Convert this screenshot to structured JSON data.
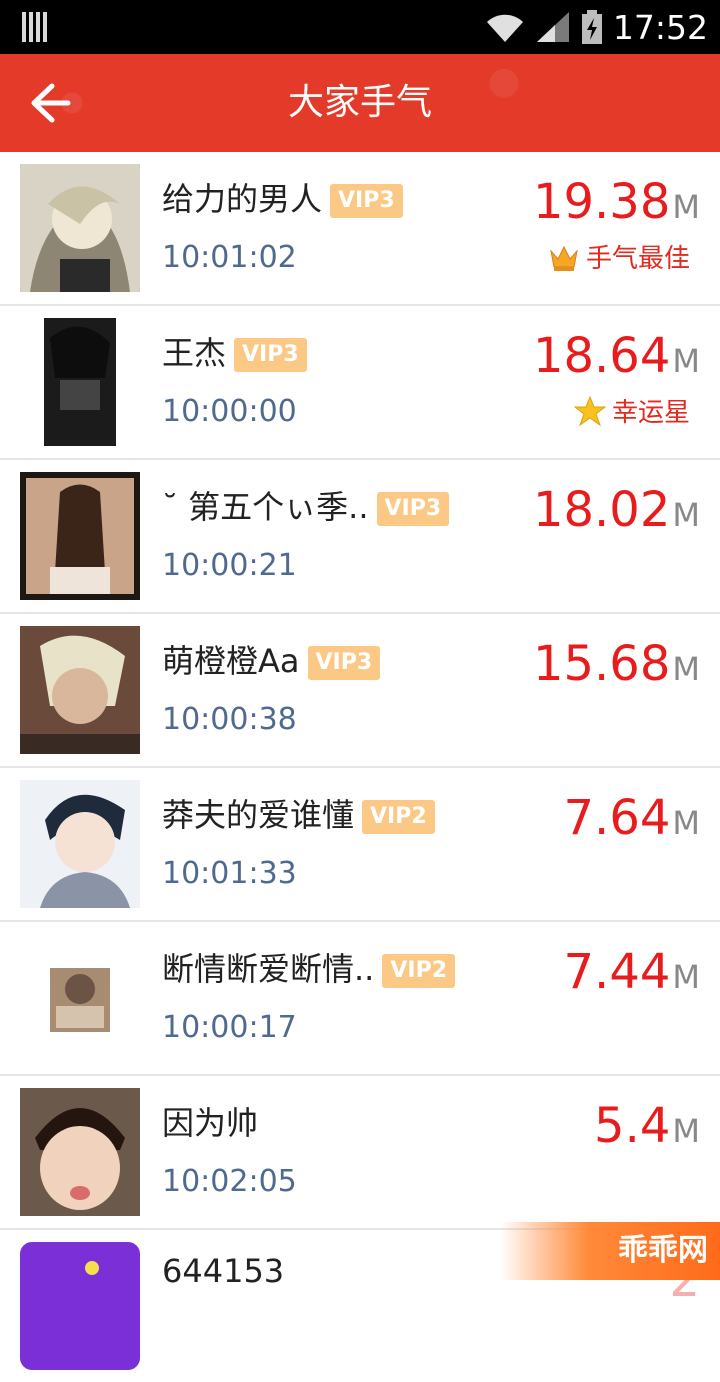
{
  "status_bar": {
    "time": "17:52"
  },
  "header": {
    "title": "大家手气"
  },
  "list": [
    {
      "name": "给力的男人",
      "vip": "VIP3",
      "time": "10:01:02",
      "amount": "19.38",
      "unit": "M",
      "badge": "手气最佳",
      "badge_icon": "crown-icon"
    },
    {
      "name": "王杰",
      "vip": "VIP3",
      "time": "10:00:00",
      "amount": "18.64",
      "unit": "M",
      "badge": "幸运星",
      "badge_icon": "star-icon"
    },
    {
      "name": "˘ 第五个ぃ季..",
      "vip": "VIP3",
      "time": "10:00:21",
      "amount": "18.02",
      "unit": "M"
    },
    {
      "name": "萌橙橙Aa",
      "vip": "VIP3",
      "time": "10:00:38",
      "amount": "15.68",
      "unit": "M"
    },
    {
      "name": "莽夫的爱谁懂",
      "vip": "VIP2",
      "time": "10:01:33",
      "amount": "7.64",
      "unit": "M"
    },
    {
      "name": "断情断爱断情..",
      "vip": "VIP2",
      "time": "10:00:17",
      "amount": "7.44",
      "unit": "M"
    },
    {
      "name": "因为帅",
      "vip": "",
      "time": "10:02:05",
      "amount": "5.4",
      "unit": "M"
    },
    {
      "name": "644153",
      "vip": "",
      "time": "",
      "amount": "2",
      "unit": ""
    }
  ],
  "watermark": "乖乖网",
  "colors": {
    "header": "#e33a2a",
    "amount": "#e81c1c",
    "vip": "#fbc886",
    "time": "#506a8f"
  }
}
